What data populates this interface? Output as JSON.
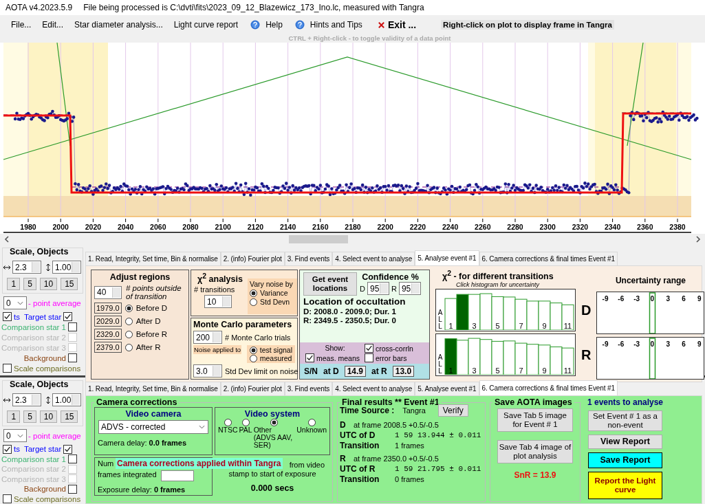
{
  "app_version": "AOTA v4.2023.5.9",
  "file_info": "File being processed is C:\\dvti\\fits\\2023_09_12_Blazewicz_173_Ino.lc, measured with Tangra",
  "menu": [
    {
      "label": "File...",
      "kind": "plain"
    },
    {
      "label": "Edit...",
      "kind": "plain"
    },
    {
      "label": "Star diameter analysis...",
      "kind": "plain"
    },
    {
      "label": "Light curve report",
      "kind": "plain"
    },
    {
      "label": "Help",
      "kind": "help"
    },
    {
      "label": "Hints and Tips",
      "kind": "help"
    },
    {
      "label": "Exit ...",
      "kind": "exit"
    }
  ],
  "plot_banner": "Right-click on plot to display frame in Tangra",
  "plot_hint": "CTRL + Right-click  -  to toggle validity of a data point",
  "plot": {
    "x_tick_labels": [
      "1980",
      "2000",
      "2020",
      "2040",
      "2060",
      "2080",
      "2100",
      "2120",
      "2140",
      "2160",
      "2180",
      "2200",
      "2220",
      "2240",
      "2260",
      "2280",
      "2300",
      "2320",
      "2340",
      "2360",
      "2380"
    ]
  },
  "panels": [
    {
      "kind": "analyse",
      "side": {
        "title": "Scale,  Objects",
        "h_scale": "2.3",
        "v_scale": "1.00",
        "zoom_buttons": [
          "1",
          "5",
          "10",
          "15"
        ],
        "average": "0",
        "average_label": "- point average",
        "show_points": {
          "label": "ts",
          "checked": true
        },
        "objects": [
          {
            "label": "Target star",
            "color": "#0000ff",
            "checked": true,
            "disabled": false
          },
          {
            "label": "Comparison star 1",
            "color": "#3cb371",
            "checked": false,
            "disabled": false
          },
          {
            "label": "Comparison star 2",
            "color": "#b4b4b4",
            "checked": false,
            "disabled": true
          },
          {
            "label": "Comparison star 3",
            "color": "#b4b4b4",
            "checked": false,
            "disabled": true
          },
          {
            "label": "Background",
            "color": "#8b4513",
            "checked": false,
            "disabled": false
          }
        ],
        "scale_comparisons": {
          "label": "Scale comparisons",
          "checked": false
        }
      },
      "tabs": [
        {
          "label": "1.  Read, Integrity, Set time, Bin & normalise",
          "selected": false
        },
        {
          "label": "2. (info)  Fourier plot",
          "selected": false
        },
        {
          "label": "3. Find events",
          "selected": false
        },
        {
          "label": "4. Select event to analyse",
          "selected": false
        },
        {
          "label": "5. Analyse event #1",
          "selected": true
        },
        {
          "label": "6. Camera corrections & final times Event #1",
          "selected": false
        }
      ],
      "adjust_regions": {
        "title": "Adjust regions",
        "points": "40",
        "points_label": "# points outside of transition",
        "regions": [
          {
            "value": "1979.0",
            "label": "Before D",
            "selected": true
          },
          {
            "value": "2029.0",
            "label": "After D",
            "selected": false
          },
          {
            "value": "2329.0",
            "label": "Before R",
            "selected": false
          },
          {
            "value": "2379.0",
            "label": "After R",
            "selected": false
          }
        ]
      },
      "chi2_analysis": {
        "title": "χ$^{2}$ analysis",
        "transitions_label": "# transitions",
        "transitions": "10",
        "noise_title": "Vary noise by",
        "noise_options": [
          {
            "label": "Variance",
            "selected": true
          },
          {
            "label": "Std Devn",
            "selected": false
          }
        ]
      },
      "monte_carlo": {
        "title": "Monte Carlo parameters",
        "trials": "200",
        "trials_label": "# Monte Carlo trials",
        "noise_label": "Noise applied to",
        "noise_targets": [
          {
            "label": "test signal",
            "selected": true
          },
          {
            "label": "measured",
            "selected": false
          }
        ],
        "limit": "3.0",
        "limit_label": "Std Dev limit on noise"
      },
      "event": {
        "button": "Get event locations",
        "confidence_title": "Confidence %",
        "confidence": [
          {
            "label": "D",
            "value": "95"
          },
          {
            "label": "R",
            "value": "95"
          }
        ],
        "location_title": "Location of occultation",
        "locations": [
          "D: 2008.0 - 2009.0; Dur. 1",
          "R: 2349.5 - 2350.5; Dur. 0"
        ],
        "show_label": "Show:",
        "show_options": [
          {
            "label": "cross-corrln",
            "checked": true
          },
          {
            "label": "meas. means",
            "checked": true
          },
          {
            "label": "error bars",
            "checked": false
          }
        ],
        "sn_label": "S/N",
        "sn": [
          {
            "label": "at D",
            "value": "14.9"
          },
          {
            "label": "at R",
            "value": "13.0"
          }
        ]
      },
      "chi2_chart": {
        "title": "χ$^{2}$ - for different transitions",
        "subtitle": "Click histogram for uncertainty",
        "histograms": [
          {
            "label": "D",
            "side_label": "ALL",
            "bars": [
              {
                "label": "1",
                "selected": false
              },
              {
                "selected": true
              },
              {
                "label": "3",
                "selected": false
              },
              {
                "selected": false
              },
              {
                "label": "5",
                "selected": false
              },
              {
                "selected": false
              },
              {
                "label": "7",
                "selected": false
              },
              {
                "selected": false
              },
              {
                "label": "9",
                "selected": false
              },
              {
                "selected": false
              },
              {
                "label": "11",
                "selected": false
              }
            ]
          },
          {
            "label": "R",
            "side_label": "ALL",
            "bars": [
              {
                "label": "1",
                "selected": true
              },
              {
                "selected": false
              },
              {
                "label": "3",
                "selected": false
              },
              {
                "selected": false
              },
              {
                "label": "5",
                "selected": false
              },
              {
                "selected": false
              },
              {
                "label": "7",
                "selected": false
              },
              {
                "selected": false
              },
              {
                "label": "9",
                "selected": false
              },
              {
                "selected": false
              },
              {
                "label": "11",
                "selected": false
              }
            ]
          }
        ]
      },
      "uncertainty": {
        "title": "Uncertainty range",
        "ranges": [
          {
            "tick_labels": [
              "-9",
              "-6",
              "-3",
              "0",
              "3",
              "6",
              "9"
            ]
          },
          {
            "tick_labels": [
              "-9",
              "-6",
              "-3",
              "0",
              "3",
              "6",
              "9"
            ]
          }
        ]
      }
    },
    {
      "kind": "final",
      "side": {
        "title": "Scale,  Objects",
        "h_scale": "2.3",
        "v_scale": "1.00",
        "zoom_buttons": [
          "1",
          "5",
          "10",
          "15"
        ],
        "average": "0",
        "average_label": "- point average",
        "show_points": {
          "label": "ts",
          "checked": true
        },
        "objects": [
          {
            "label": "Target star",
            "color": "#0000ff",
            "checked": true,
            "disabled": false
          },
          {
            "label": "Comparison star 1",
            "color": "#3cb371",
            "checked": false,
            "disabled": false
          },
          {
            "label": "Comparison star 2",
            "color": "#b4b4b4",
            "checked": false,
            "disabled": true
          },
          {
            "label": "Comparison star 3",
            "color": "#b4b4b4",
            "checked": false,
            "disabled": true
          },
          {
            "label": "Background",
            "color": "#8b4513",
            "checked": false,
            "disabled": false
          }
        ],
        "scale_comparisons": {
          "label": "Scale comparisons",
          "checked": false
        }
      },
      "tabs": [
        {
          "label": "1.  Read, Integrity, Set time, Bin & normalise",
          "selected": false
        },
        {
          "label": "2. (info)  Fourier plot",
          "selected": false
        },
        {
          "label": "3. Find events",
          "selected": false
        },
        {
          "label": "4. Select event to analyse",
          "selected": false
        },
        {
          "label": "5. Analyse event #1",
          "selected": false
        },
        {
          "label": "6. Camera corrections & final times Event #1",
          "selected": true
        }
      ],
      "camera_corrections": {
        "title": "Camera corrections",
        "camera_title": "Video camera",
        "camera": "ADVS - corrected",
        "camera_delay": "Camera delay: **0.0 frames**",
        "system_title": "Video system",
        "systems": [
          {
            "label": "NTSC",
            "selected": false
          },
          {
            "label": "PAL",
            "selected": false
          },
          {
            "label": "Other (ADVS AAV, SER)",
            "selected": true
          },
          {
            "label": "Unknown",
            "selected": false
          }
        ],
        "integration_start": "Num",
        "integration_end": "frames integrated",
        "exposure_delay": "Exposure delay: **0 frames**",
        "offset_lines": [
          "from video",
          "stamp to start of exposure"
        ],
        "offset": "0.000 secs",
        "banner": "Camera corrections applied within Tangra"
      },
      "final_results": {
        "title": "Final results  **  Event #1",
        "verify": "Verify",
        "time_source_label": "Time Source :",
        "time_source": "Tangra",
        "events": [
          {
            "label": "D",
            "frame": "at frame 2008.5  +0.5/-0.5",
            "utc_label": "UTC of D",
            "utc": "1 59 13.944 ± 0.011",
            "transition_label": "Transition",
            "transition": "1 frames"
          },
          {
            "label": "R",
            "frame": "at frame 2350.0  +0.5/-0.5",
            "utc_label": "UTC of R",
            "utc": "1 59 21.795 ± 0.011",
            "transition_label": "Transition",
            "transition": "0 frames"
          }
        ]
      },
      "save_images": {
        "title": "Save AOTA images",
        "buttons": [
          "Save Tab 5 image for Event # 1",
          "Save Tab 4 image of plot analysis"
        ],
        "snr": "SnR = 13.9"
      },
      "events_panel": {
        "count_label": "1  events to analyse",
        "buttons": [
          {
            "label": "Set Event # 1 as a non-event",
            "kind": "plain"
          },
          {
            "label": "View Report",
            "kind": "bold"
          },
          {
            "label": "Save Report",
            "kind": "save"
          },
          {
            "label": "Report the Light curve",
            "kind": "report"
          }
        ]
      }
    }
  ]
}
